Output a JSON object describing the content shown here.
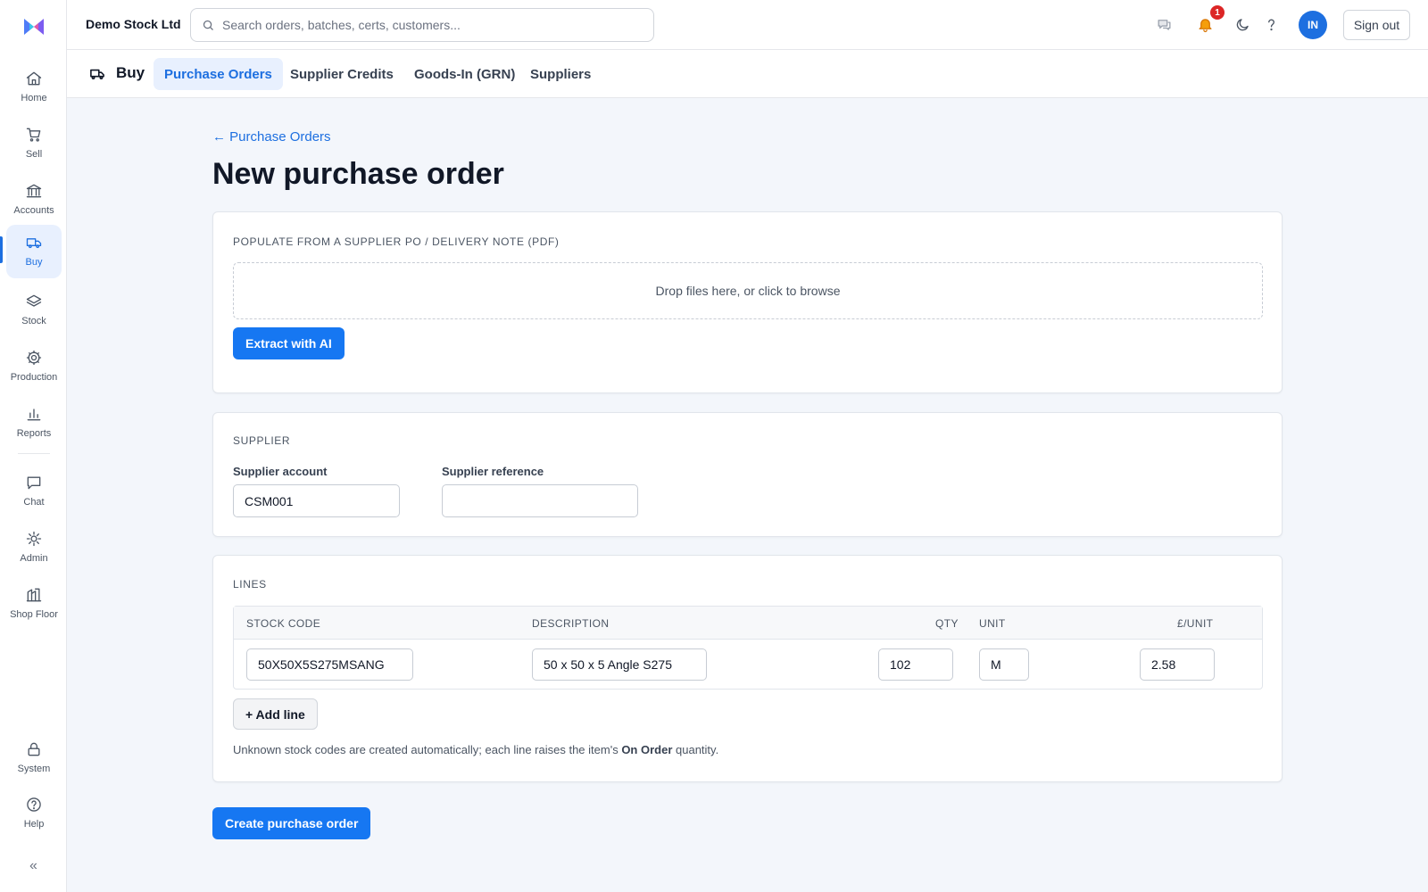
{
  "app": {
    "company": "Demo Stock Ltd",
    "search_placeholder": "Search orders, batches, certs, customers...",
    "notifications_count": "1",
    "avatar_initials": "IN",
    "sign_out_label": "Sign out",
    "brand_color": "#1677f2"
  },
  "sidebar": {
    "items": [
      {
        "label": "Home",
        "icon": "home-icon"
      },
      {
        "label": "Sell",
        "icon": "cart-icon"
      },
      {
        "label": "Accounts",
        "icon": "bank-icon"
      },
      {
        "label": "Buy",
        "icon": "truck-icon",
        "active": true
      },
      {
        "label": "Stock",
        "icon": "layers-icon"
      },
      {
        "label": "Production",
        "icon": "gear-icon"
      },
      {
        "label": "Reports",
        "icon": "bar-chart-icon"
      },
      {
        "label": "Chat",
        "icon": "chat-icon"
      },
      {
        "label": "Admin",
        "icon": "sun-cog-icon"
      },
      {
        "label": "Shop Floor",
        "icon": "factory-icon"
      }
    ],
    "bottom": [
      {
        "label": "System",
        "icon": "lock-icon"
      },
      {
        "label": "Help",
        "icon": "help-icon"
      }
    ],
    "collapse_label": "«"
  },
  "subnav": {
    "title": "Buy",
    "tabs": [
      {
        "label": "Purchase Orders",
        "active": true
      },
      {
        "label": "Supplier Credits"
      },
      {
        "label": "Goods-In (GRN)"
      },
      {
        "label": "Suppliers"
      }
    ]
  },
  "page": {
    "back_link": "← Purchase Orders",
    "title": "New purchase order"
  },
  "populate": {
    "section_title": "POPULATE FROM A SUPPLIER PO / DELIVERY NOTE (PDF)",
    "dropzone_text": "Drop files here, or click to browse",
    "extract_label": "Extract with AI"
  },
  "supplier": {
    "section_title": "SUPPLIER",
    "account_label": "Supplier account",
    "account_value": "CSM001",
    "reference_label": "Supplier reference",
    "reference_value": ""
  },
  "lines": {
    "section_title": "LINES",
    "columns": [
      "STOCK CODE",
      "DESCRIPTION",
      "QTY",
      "UNIT",
      "£/UNIT"
    ],
    "rows": [
      {
        "stock_code": "50X50X5S275MSANG",
        "description": "50 x 50 x 5 Angle S275",
        "qty": "102",
        "unit": "M",
        "price": "2.58"
      }
    ],
    "add_line_label": "+ Add line",
    "hint_before": "Unknown stock codes are created automatically; each line raises the item's ",
    "hint_bold": "On Order",
    "hint_after": " quantity."
  },
  "create_label": "Create purchase order"
}
